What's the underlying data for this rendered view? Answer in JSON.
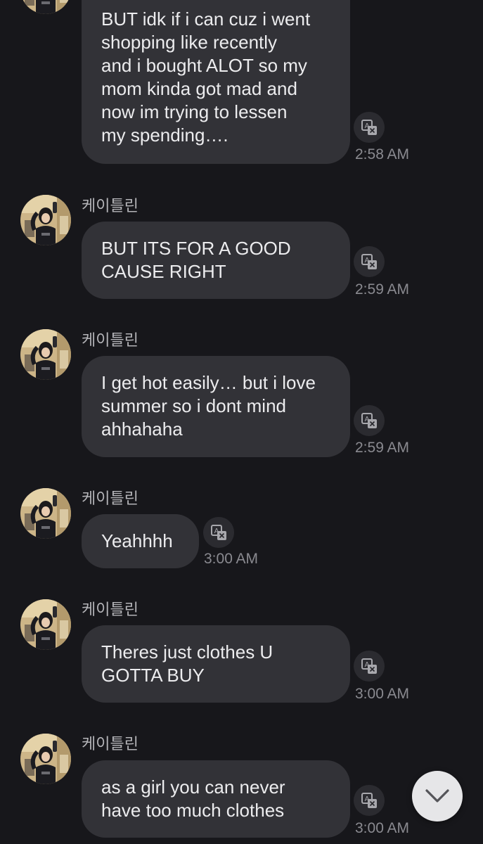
{
  "sender_name": "케이틀린",
  "messages": [
    {
      "text": "BUT idk if i can cuz i went\nshopping  like recently\nand i bought ALOT so my\nmom kinda got mad and\nnow im trying to lessen\nmy spending….",
      "time": "2:58 AM"
    },
    {
      "text": "BUT ITS FOR A GOOD\nCAUSE RIGHT",
      "time": "2:59 AM"
    },
    {
      "text": "I get hot easily… but i love\nsummer so i dont mind\nahhahaha",
      "time": "2:59 AM"
    },
    {
      "text": "Yeahhhh",
      "time": "3:00 AM"
    },
    {
      "text": "Theres just clothes U\nGOTTA BUY",
      "time": "3:00 AM"
    },
    {
      "text": "as a girl you can never\nhave too much clothes",
      "time": "3:00 AM"
    }
  ],
  "icons": {
    "translate": "translate-icon",
    "scroll_down": "chevron-down-icon"
  },
  "colors": {
    "background": "#17171b",
    "bubble": "#323237",
    "text": "#ececee",
    "timestamp": "#8a8a90"
  }
}
